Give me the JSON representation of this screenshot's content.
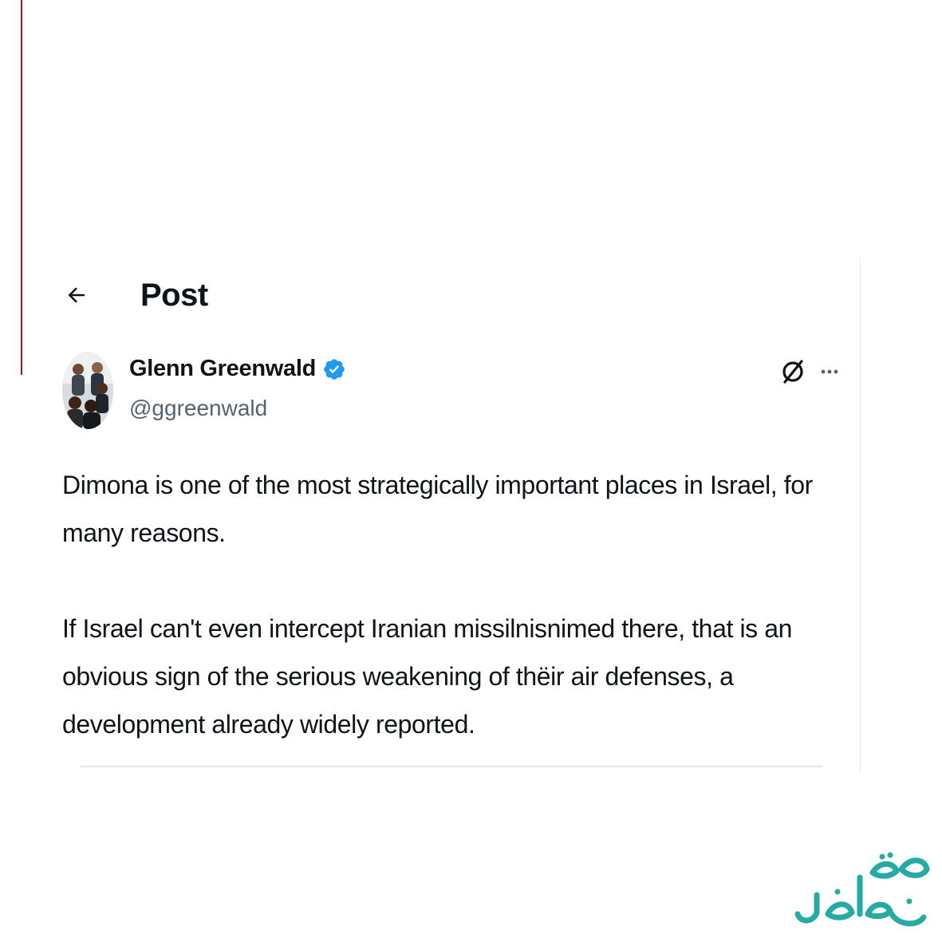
{
  "header": {
    "back_icon": "arrow-left-icon",
    "title": "Post"
  },
  "tweet": {
    "author": {
      "display_name": "Glenn Greenwald",
      "handle": "@ggreenwald",
      "verified": true,
      "avatar": "group-photo-avatar"
    },
    "actions": {
      "grok_icon": "grok-icon",
      "more_icon": "more-dots-icon"
    },
    "paragraphs": [
      "Dimona is one of the most strategically important places in Israel, for many reasons.",
      "If Israel can't even intercept Iranian missilnisnimed there, that is an obvious sign of the serious weakening of thëir air defenses, a development already widely reported."
    ]
  },
  "watermark": {
    "text": "صفحه اقتصاد",
    "color": "#1aa7a0"
  },
  "colors": {
    "text_primary": "#0f1419",
    "text_secondary": "#536471",
    "verified_blue": "#1d9bf0",
    "accent_rule": "#8a1f2a"
  }
}
